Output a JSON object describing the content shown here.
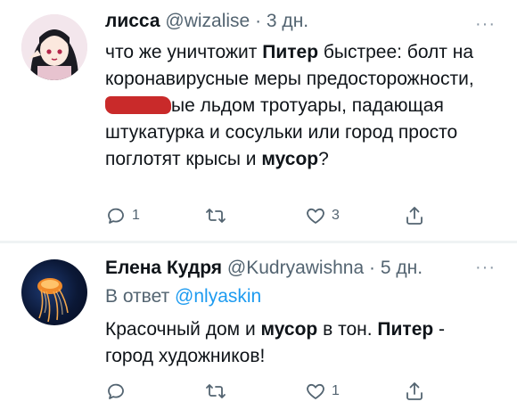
{
  "tweets": [
    {
      "author_name": "лисса",
      "handle": "@wizalise",
      "separator": "·",
      "time": "3 дн.",
      "more": "···",
      "body": {
        "p1": "что же уничтожит ",
        "b1": "Питер",
        "p2": " быстрее: болт на коронавирусные меры предосторожности, ",
        "p3": "ые льдом тротуары, падающая штукатурка и сосульки или город просто поглотят крысы и ",
        "b2": "мусор",
        "p4": "?"
      },
      "replies": "1",
      "retweets": "",
      "likes": "3"
    },
    {
      "author_name": "Елена Кудря",
      "handle": "@Kudryawishna",
      "separator": "·",
      "time": "5 дн.",
      "more": "···",
      "reply_to_label": "В ответ ",
      "reply_to_handle": "@nlyaskin",
      "body": {
        "p1": "Красочный дом и ",
        "b1": "мусор",
        "p2": " в тон. ",
        "b2": "Питер",
        "p3": " - город художников!"
      },
      "replies": "",
      "retweets": "",
      "likes": "1"
    }
  ],
  "icons": {
    "reply": "reply-icon",
    "retweet": "retweet-icon",
    "like": "heart-icon",
    "share": "share-icon"
  },
  "colors": {
    "text": "#0f1419",
    "secondary": "#536471",
    "link": "#1d9bf0",
    "divider": "#eff3f4",
    "redaction": "#c41818"
  }
}
